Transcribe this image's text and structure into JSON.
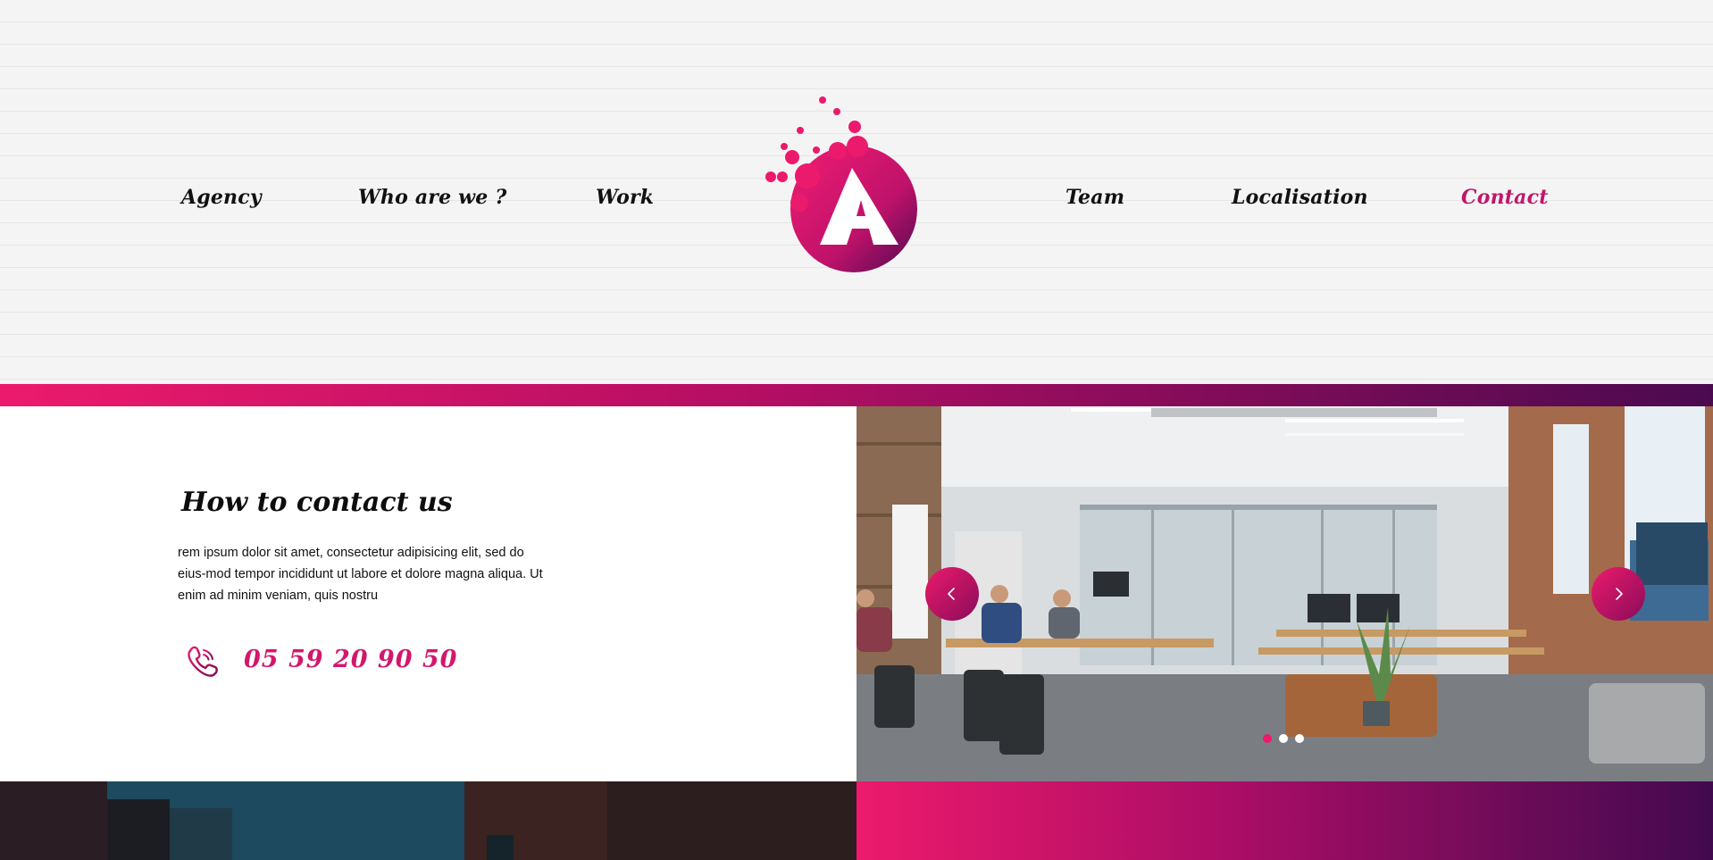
{
  "nav": {
    "left": [
      "Agency",
      "Who are we ?",
      "Work"
    ],
    "right": [
      "Team",
      "Localisation",
      "Contact"
    ],
    "active": "Contact"
  },
  "logo": {
    "letter": "A",
    "icon": "bubble-a-logo"
  },
  "contact": {
    "title": "How to contact us",
    "body": "rem ipsum dolor sit amet, consectetur adipisicing elit, sed do eius-mod tempor incididunt ut labore et dolore magna aliqua. Ut enim ad minim veniam, quis nostru",
    "phone": "05 59 20 90 50",
    "phone_icon": "phone-icon"
  },
  "slider": {
    "image": "office-photo",
    "prev_icon": "chevron-left-icon",
    "next_icon": "chevron-right-icon",
    "slide_count": 3,
    "active_slide": 1
  },
  "colors": {
    "accent": "#ec1a6c",
    "accent_dark": "#4b0a4f",
    "text": "#111111",
    "header_bg": "#f4f4f4"
  }
}
